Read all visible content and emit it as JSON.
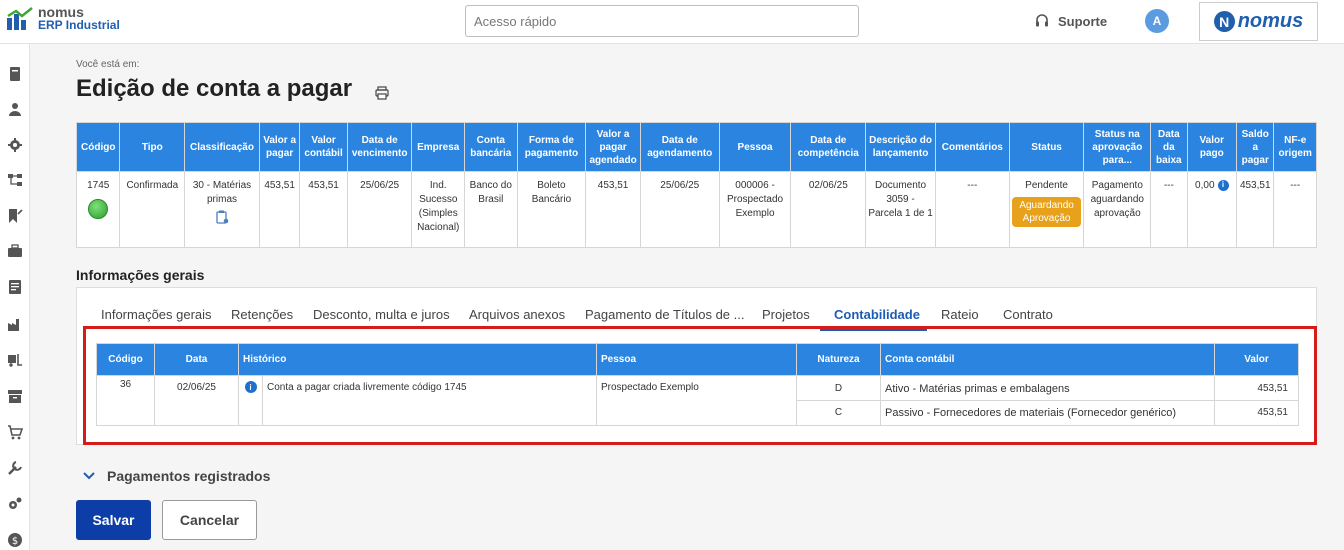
{
  "header": {
    "logo_line1": "nomus",
    "logo_line2": "ERP Industrial",
    "quick_access_placeholder": "Acesso rápido",
    "support_label": "Suporte",
    "avatar_initial": "A",
    "brand_letter": "N",
    "brand_name": "nomus"
  },
  "sidebar": {
    "icons": [
      "book-icon",
      "user-icon",
      "gear-icon",
      "flow-icon",
      "bookmark-icon",
      "briefcase-icon",
      "report-icon",
      "factory-icon",
      "forklift-icon",
      "box-icon",
      "cart-icon",
      "tool-icon",
      "settings-icon",
      "dollar-icon"
    ]
  },
  "page": {
    "breadcrumb": "Você está em:",
    "title": "Edição de conta a pagar"
  },
  "summary": {
    "headers": [
      "Código",
      "Tipo",
      "Classificação",
      "Valor a pagar",
      "Valor contábil",
      "Data de vencimento",
      "Empresa",
      "Conta bancária",
      "Forma de pagamento",
      "Valor a pagar agendado",
      "Data de agendamento",
      "Pessoa",
      "Data de competência",
      "Descrição do lançamento",
      "Comentários",
      "Status",
      "Status na aprovação para...",
      "Data da baixa",
      "Valor pago",
      "Saldo a pagar",
      "NF-e origem"
    ],
    "row": {
      "codigo": "1745",
      "tipo": "Confirmada",
      "classificacao": "30 - Matérias primas",
      "valor_a_pagar": "453,51",
      "valor_contabil": "453,51",
      "data_vencimento": "25/06/25",
      "empresa": "Ind. Sucesso (Simples Nacional)",
      "conta_bancaria": "Banco do Brasil",
      "forma_pagamento": "Boleto Bancário",
      "valor_agendado": "453,51",
      "data_agendamento": "25/06/25",
      "pessoa": "000006 - Prospectado Exemplo",
      "data_competencia": "02/06/25",
      "descricao": "Documento 3059 - Parcela 1 de 1",
      "comentarios": "---",
      "status": "Pendente",
      "status_badge": "Aguardando Aprovação",
      "status_aprovacao": "Pagamento aguardando aprovação",
      "data_baixa": "---",
      "valor_pago": "0,00",
      "saldo_a_pagar": "453,51",
      "nfe_origem": "---"
    }
  },
  "section_title": "Informações gerais",
  "tabs": [
    {
      "label": "Informações gerais"
    },
    {
      "label": "Retenções"
    },
    {
      "label": "Desconto, multa e juros"
    },
    {
      "label": "Arquivos anexos"
    },
    {
      "label": "Pagamento de Títulos de ..."
    },
    {
      "label": "Projetos"
    },
    {
      "label": "Contabilidade"
    },
    {
      "label": "Rateio"
    },
    {
      "label": "Contrato"
    }
  ],
  "active_tab": "Contabilidade",
  "accounting": {
    "headers": {
      "codigo": "Código",
      "data": "Data",
      "historico": "Histórico",
      "pessoa": "Pessoa",
      "natureza": "Natureza",
      "conta": "Conta contábil",
      "valor": "Valor"
    },
    "codigo": "36",
    "data": "02/06/25",
    "historico": "Conta a pagar criada livremente código 1745",
    "pessoa": "Prospectado Exemplo",
    "entries": [
      {
        "natureza": "D",
        "conta": "Ativo - Matérias primas e embalagens",
        "valor": "453,51"
      },
      {
        "natureza": "C",
        "conta": "Passivo - Fornecedores de materiais (Fornecedor genérico)",
        "valor": "453,51"
      }
    ]
  },
  "pagamentos_label": "Pagamentos registrados",
  "buttons": {
    "save": "Salvar",
    "cancel": "Cancelar"
  },
  "colors": {
    "header_blue": "#2a84e0",
    "primary": "#0d3ea8",
    "highlight_red": "#d71a1a",
    "badge_orange": "#e7a11a"
  }
}
